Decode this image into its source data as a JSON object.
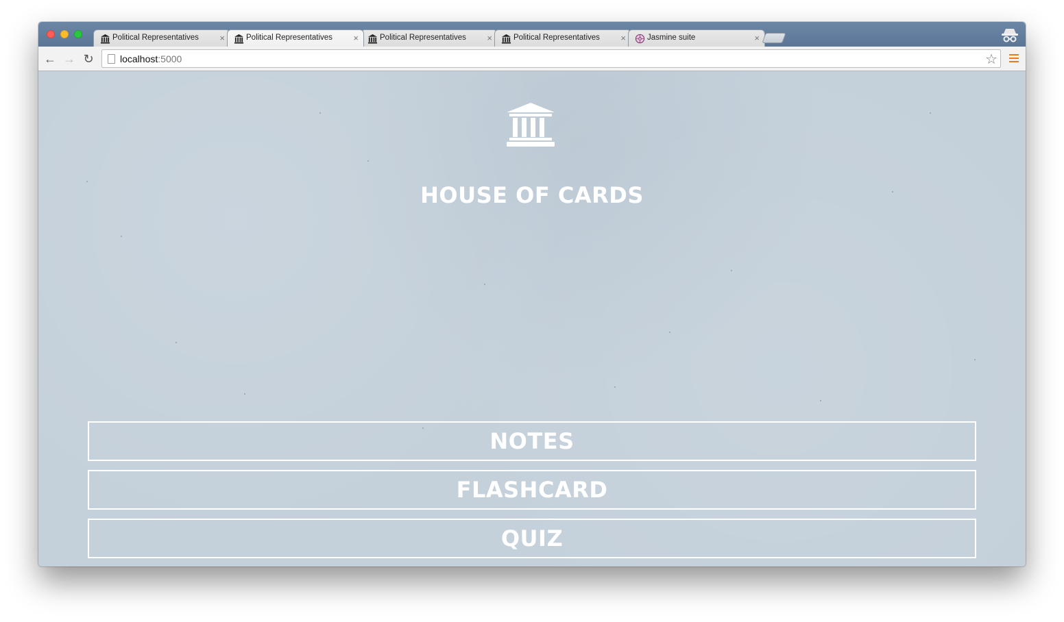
{
  "browser": {
    "tabs": [
      {
        "title": "Political Representatives",
        "favicon": "capitol-icon",
        "active": false
      },
      {
        "title": "Political Representatives",
        "favicon": "capitol-icon",
        "active": true
      },
      {
        "title": "Political Representatives",
        "favicon": "capitol-icon",
        "active": false
      },
      {
        "title": "Political Representatives",
        "favicon": "capitol-icon",
        "active": false
      },
      {
        "title": "Jasmine suite",
        "favicon": "jasmine-icon",
        "active": false
      }
    ],
    "tab_close_glyph": "×",
    "address": {
      "host": "localhost",
      "port": ":5000"
    },
    "colors": {
      "tabstrip": "#5a7596",
      "menu_accent": "#e87c1a"
    }
  },
  "page": {
    "title": "HOUSE OF CARDS",
    "logo_icon": "capitol-building-icon",
    "background_color": "#c4d0da",
    "text_color": "#ffffff",
    "menu": [
      {
        "label": "NOTES"
      },
      {
        "label": "FLASHCARD"
      },
      {
        "label": "QUIZ"
      }
    ]
  }
}
